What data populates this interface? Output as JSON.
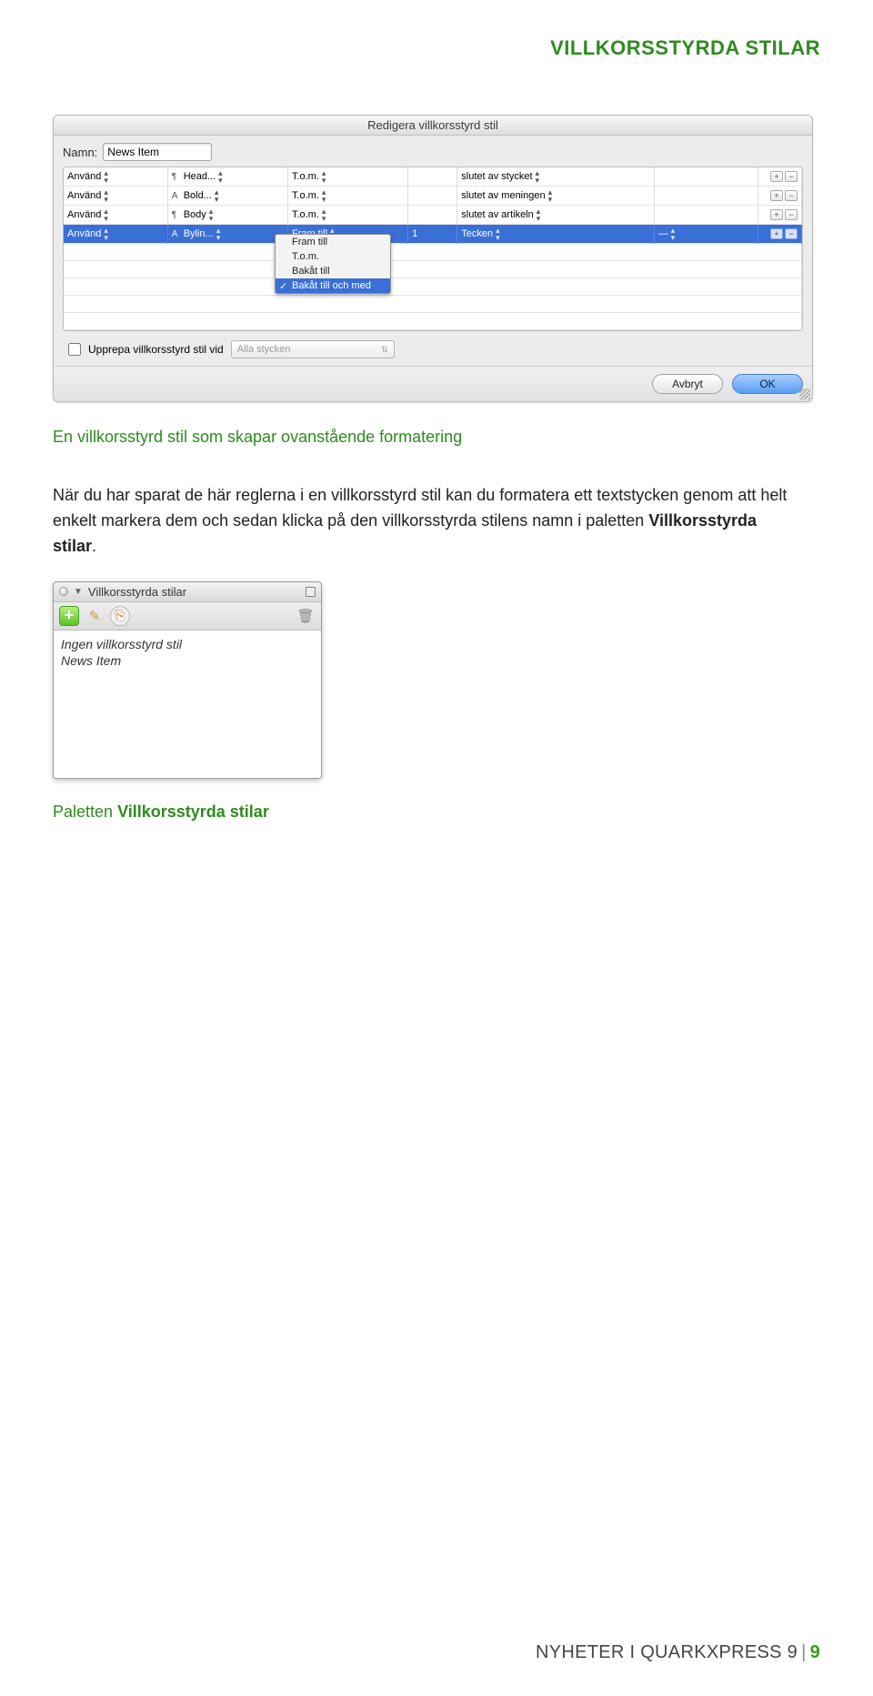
{
  "header": {
    "title": "VILLKORSSTYRDA STILAR"
  },
  "dialog": {
    "title": "Redigera villkorsstyrd stil",
    "name_label": "Namn:",
    "name_value": "News Item",
    "columns_width": [
      "95",
      "110",
      "110",
      "45",
      "180",
      "95",
      "40"
    ],
    "rows": [
      {
        "c1": "Använd",
        "c2_icon": "¶",
        "c2": "Head...",
        "c3": "T.o.m.",
        "c4": "",
        "c5": "slutet av stycket",
        "c6": "",
        "pm": true,
        "selected": false
      },
      {
        "c1": "Använd",
        "c2_icon": "A",
        "c2": "Bold...",
        "c3": "T.o.m.",
        "c4": "",
        "c5": "slutet av meningen",
        "c6": "",
        "pm": true,
        "selected": false
      },
      {
        "c1": "Använd",
        "c2_icon": "¶",
        "c2": "Body",
        "c3": "T.o.m.",
        "c4": "",
        "c5": "slutet av artikeln",
        "c6": "",
        "pm": true,
        "selected": false
      },
      {
        "c1": "Använd",
        "c2_icon": "A",
        "c2": "Bylin...",
        "c3": "Fram till",
        "c4": "1",
        "c5": "Tecken",
        "c6": "—",
        "pm": true,
        "selected": true
      }
    ],
    "popup": {
      "options": [
        "Fram till",
        "T.o.m.",
        "Bakåt till",
        "Bakåt till och med"
      ],
      "selected_index": 3
    },
    "repeat": {
      "checkbox_label": "Upprepa villkorsstyrd stil vid",
      "select_value": "Alla stycken",
      "checked": false
    },
    "buttons": {
      "cancel": "Avbryt",
      "ok": "OK"
    }
  },
  "paragraph": {
    "text_pre": "En villkorsstyrd stil som skapar ovanstående formatering",
    "text_body": "När du har sparat de här reglerna i en villkorsstyrd stil kan du formatera ett textstycken genom att helt enkelt markera dem och sedan klicka på den villkorsstyrda stilens namn i paletten ",
    "text_bold": "Villkorsstyrda stilar",
    "text_after": "."
  },
  "palette": {
    "title": "Villkorsstyrda stilar",
    "items": [
      "Ingen villkorsstyrd stil",
      "News Item"
    ],
    "icons": {
      "add": "+",
      "edit": "✎",
      "dup": "⎘",
      "trash": "🗑"
    }
  },
  "caption": {
    "pre": "Paletten ",
    "bold": "Villkorsstyrda stilar"
  },
  "footer": {
    "left": "NYHETER I QUARKXPRESS 9",
    "page": "9"
  }
}
